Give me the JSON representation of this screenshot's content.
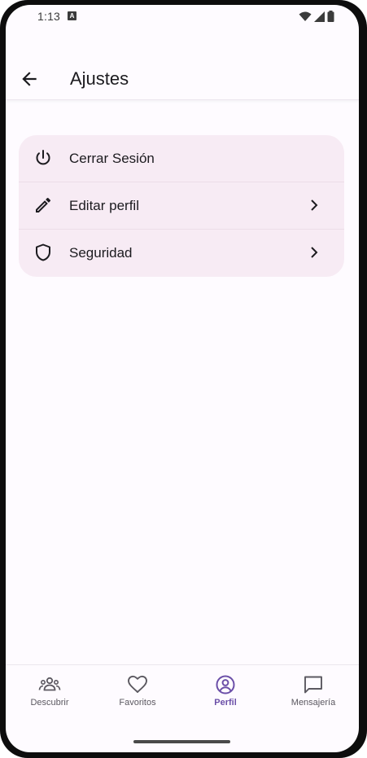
{
  "status_bar": {
    "time": "1:13",
    "notification_letter": "A"
  },
  "app_bar": {
    "title": "Ajustes"
  },
  "settings": {
    "items": [
      {
        "label": "Cerrar Sesión",
        "icon": "power-icon",
        "has_chevron": false
      },
      {
        "label": "Editar perfil",
        "icon": "pencil-icon",
        "has_chevron": true
      },
      {
        "label": "Seguridad",
        "icon": "shield-icon",
        "has_chevron": true
      }
    ]
  },
  "bottom_nav": {
    "items": [
      {
        "label": "Descubrir",
        "icon": "group-icon",
        "active": false
      },
      {
        "label": "Favoritos",
        "icon": "heart-icon",
        "active": false
      },
      {
        "label": "Perfil",
        "icon": "account-circle-icon",
        "active": true
      },
      {
        "label": "Mensajería",
        "icon": "chat-bubble-icon",
        "active": false
      }
    ]
  },
  "colors": {
    "card_background": "#f7ebf4",
    "accent": "#6b4fa8",
    "text_primary": "#1c1b1f",
    "screen_background": "#fefbff"
  }
}
